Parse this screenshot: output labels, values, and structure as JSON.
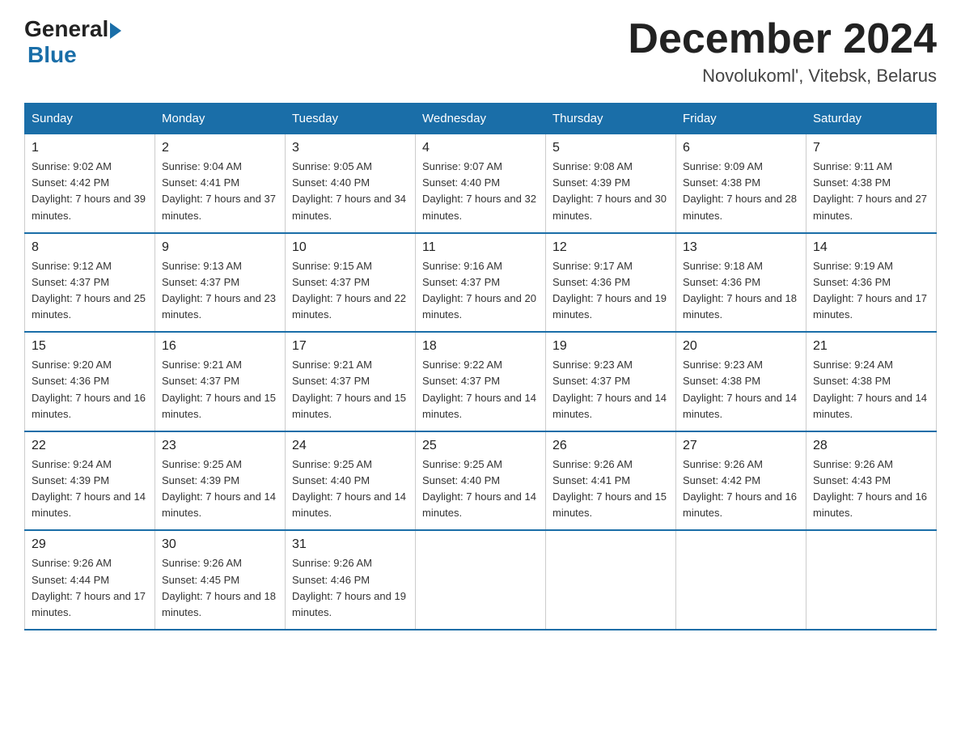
{
  "header": {
    "logo_general": "General",
    "logo_blue": "Blue",
    "title": "December 2024",
    "subtitle": "Novolukoml', Vitebsk, Belarus"
  },
  "days_of_week": [
    "Sunday",
    "Monday",
    "Tuesday",
    "Wednesday",
    "Thursday",
    "Friday",
    "Saturday"
  ],
  "weeks": [
    [
      {
        "day": "1",
        "sunrise": "9:02 AM",
        "sunset": "4:42 PM",
        "daylight": "7 hours and 39 minutes."
      },
      {
        "day": "2",
        "sunrise": "9:04 AM",
        "sunset": "4:41 PM",
        "daylight": "7 hours and 37 minutes."
      },
      {
        "day": "3",
        "sunrise": "9:05 AM",
        "sunset": "4:40 PM",
        "daylight": "7 hours and 34 minutes."
      },
      {
        "day": "4",
        "sunrise": "9:07 AM",
        "sunset": "4:40 PM",
        "daylight": "7 hours and 32 minutes."
      },
      {
        "day": "5",
        "sunrise": "9:08 AM",
        "sunset": "4:39 PM",
        "daylight": "7 hours and 30 minutes."
      },
      {
        "day": "6",
        "sunrise": "9:09 AM",
        "sunset": "4:38 PM",
        "daylight": "7 hours and 28 minutes."
      },
      {
        "day": "7",
        "sunrise": "9:11 AM",
        "sunset": "4:38 PM",
        "daylight": "7 hours and 27 minutes."
      }
    ],
    [
      {
        "day": "8",
        "sunrise": "9:12 AM",
        "sunset": "4:37 PM",
        "daylight": "7 hours and 25 minutes."
      },
      {
        "day": "9",
        "sunrise": "9:13 AM",
        "sunset": "4:37 PM",
        "daylight": "7 hours and 23 minutes."
      },
      {
        "day": "10",
        "sunrise": "9:15 AM",
        "sunset": "4:37 PM",
        "daylight": "7 hours and 22 minutes."
      },
      {
        "day": "11",
        "sunrise": "9:16 AM",
        "sunset": "4:37 PM",
        "daylight": "7 hours and 20 minutes."
      },
      {
        "day": "12",
        "sunrise": "9:17 AM",
        "sunset": "4:36 PM",
        "daylight": "7 hours and 19 minutes."
      },
      {
        "day": "13",
        "sunrise": "9:18 AM",
        "sunset": "4:36 PM",
        "daylight": "7 hours and 18 minutes."
      },
      {
        "day": "14",
        "sunrise": "9:19 AM",
        "sunset": "4:36 PM",
        "daylight": "7 hours and 17 minutes."
      }
    ],
    [
      {
        "day": "15",
        "sunrise": "9:20 AM",
        "sunset": "4:36 PM",
        "daylight": "7 hours and 16 minutes."
      },
      {
        "day": "16",
        "sunrise": "9:21 AM",
        "sunset": "4:37 PM",
        "daylight": "7 hours and 15 minutes."
      },
      {
        "day": "17",
        "sunrise": "9:21 AM",
        "sunset": "4:37 PM",
        "daylight": "7 hours and 15 minutes."
      },
      {
        "day": "18",
        "sunrise": "9:22 AM",
        "sunset": "4:37 PM",
        "daylight": "7 hours and 14 minutes."
      },
      {
        "day": "19",
        "sunrise": "9:23 AM",
        "sunset": "4:37 PM",
        "daylight": "7 hours and 14 minutes."
      },
      {
        "day": "20",
        "sunrise": "9:23 AM",
        "sunset": "4:38 PM",
        "daylight": "7 hours and 14 minutes."
      },
      {
        "day": "21",
        "sunrise": "9:24 AM",
        "sunset": "4:38 PM",
        "daylight": "7 hours and 14 minutes."
      }
    ],
    [
      {
        "day": "22",
        "sunrise": "9:24 AM",
        "sunset": "4:39 PM",
        "daylight": "7 hours and 14 minutes."
      },
      {
        "day": "23",
        "sunrise": "9:25 AM",
        "sunset": "4:39 PM",
        "daylight": "7 hours and 14 minutes."
      },
      {
        "day": "24",
        "sunrise": "9:25 AM",
        "sunset": "4:40 PM",
        "daylight": "7 hours and 14 minutes."
      },
      {
        "day": "25",
        "sunrise": "9:25 AM",
        "sunset": "4:40 PM",
        "daylight": "7 hours and 14 minutes."
      },
      {
        "day": "26",
        "sunrise": "9:26 AM",
        "sunset": "4:41 PM",
        "daylight": "7 hours and 15 minutes."
      },
      {
        "day": "27",
        "sunrise": "9:26 AM",
        "sunset": "4:42 PM",
        "daylight": "7 hours and 16 minutes."
      },
      {
        "day": "28",
        "sunrise": "9:26 AM",
        "sunset": "4:43 PM",
        "daylight": "7 hours and 16 minutes."
      }
    ],
    [
      {
        "day": "29",
        "sunrise": "9:26 AM",
        "sunset": "4:44 PM",
        "daylight": "7 hours and 17 minutes."
      },
      {
        "day": "30",
        "sunrise": "9:26 AM",
        "sunset": "4:45 PM",
        "daylight": "7 hours and 18 minutes."
      },
      {
        "day": "31",
        "sunrise": "9:26 AM",
        "sunset": "4:46 PM",
        "daylight": "7 hours and 19 minutes."
      },
      null,
      null,
      null,
      null
    ]
  ]
}
